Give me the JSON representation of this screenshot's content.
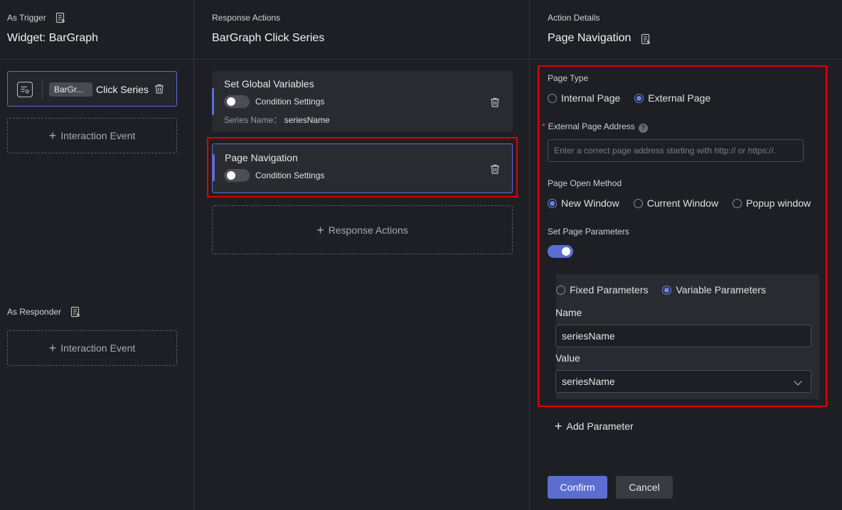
{
  "trigger": {
    "section_label": "As Trigger",
    "title": "Widget: BarGraph",
    "event": {
      "chip": "BarGr...",
      "label": "Click Series"
    },
    "add_event": "Interaction Event"
  },
  "responder": {
    "section_label": "As Responder",
    "add_event": "Interaction Event"
  },
  "responses": {
    "section_label": "Response Actions",
    "title": "BarGraph Click Series",
    "actions": [
      {
        "name": "Set Global Variables",
        "condition": "Condition Settings",
        "meta_label": "Series Name：",
        "meta_value": "seriesName"
      },
      {
        "name": "Page Navigation",
        "condition": "Condition Settings"
      }
    ],
    "add_action": "Response Actions"
  },
  "details": {
    "section_label": "Action Details",
    "title": "Page Navigation",
    "page_type": {
      "label": "Page Type",
      "options": [
        "Internal Page",
        "External Page"
      ],
      "selected": "External Page"
    },
    "address": {
      "label": "External Page Address",
      "required_mark": "*",
      "help": "?",
      "placeholder": "Enter a correct page address starting with http:// or https://."
    },
    "open_method": {
      "label": "Page Open Method",
      "options": [
        "New Window",
        "Current Window",
        "Popup window"
      ],
      "selected": "New Window"
    },
    "page_params": {
      "label": "Set Page Parameters",
      "enabled": true
    },
    "param_type": {
      "options": [
        "Fixed Parameters",
        "Variable Parameters"
      ],
      "selected": "Variable Parameters"
    },
    "name": {
      "label": "Name",
      "value": "seriesName"
    },
    "value": {
      "label": "Value",
      "selected": "seriesName"
    },
    "add_param": "Add Parameter",
    "confirm": "Confirm",
    "cancel": "Cancel"
  },
  "colors": {
    "accent": "#5b6ed0",
    "highlight": "#e00000",
    "background": "#1e1f24"
  }
}
